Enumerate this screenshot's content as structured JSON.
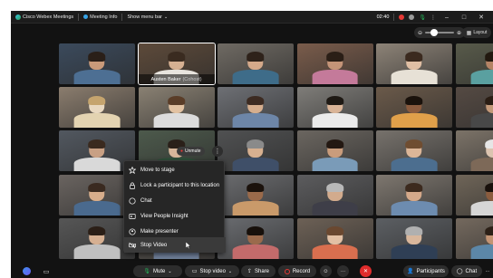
{
  "titlebar": {
    "app_name": "Cisco Webex Meetings",
    "meeting_info": "Meeting Info",
    "show_menu_bar": "Show menu bar",
    "time": "02:40"
  },
  "top_controls": {
    "layout_label": "Layout",
    "zoom_level": 0.3
  },
  "tiles": [
    {
      "bg": "#3b4a5c",
      "skin": "#c99a7a",
      "hair": "#2a1f18",
      "shirt": "#4d6f93"
    },
    {
      "bg": "#5d4a3a",
      "skin": "#d6b092",
      "hair": "#3a2b20",
      "shirt": "#e8e4de",
      "name": "Austen Baker",
      "role": "(Cohost)",
      "active": true
    },
    {
      "bg": "#6f6a63",
      "skin": "#d4a98a",
      "hair": "#2e221a",
      "shirt": "#3e6c89"
    },
    {
      "bg": "#7a5c4b",
      "skin": "#c49478",
      "hair": "#2a1e16",
      "shirt": "#c47a9a"
    },
    {
      "bg": "#8d8377",
      "skin": "#e0bfa4",
      "hair": "#3b2a1f",
      "shirt": "#e7e1d6"
    },
    {
      "bg": "#585a4a",
      "skin": "#b48365",
      "hair": "#22180f",
      "shirt": "#5aa0a0"
    },
    {
      "bg": "#8b7d6e",
      "skin": "#e8d8c0",
      "hair": "#c5a46e",
      "shirt": "#e3d3b1"
    },
    {
      "bg": "#8a8173",
      "skin": "#e2c2a2",
      "hair": "#5a3d28",
      "shirt": "#dcdcdc"
    },
    {
      "bg": "#6e7075",
      "skin": "#d5ae8e",
      "hair": "#3c2b22",
      "shirt": "#6d86a8"
    },
    {
      "bg": "#7f7d79",
      "skin": "#d9b497",
      "hair": "#1e1914",
      "shirt": "#ebebeb"
    },
    {
      "bg": "#6b5a4a",
      "skin": "#8a5b3e",
      "hair": "#1a120c",
      "shirt": "#e0a04a"
    },
    {
      "bg": "#554a43",
      "skin": "#c49a7a",
      "hair": "#2a1d14",
      "shirt": "#484848"
    },
    {
      "bg": "#525860",
      "skin": "#c8a084",
      "hair": "#3a2a1f",
      "shirt": "#d9d9d9"
    },
    {
      "bg": "#4d5a4c",
      "skin": "#d6b69a",
      "hair": "#2a2019",
      "shirt": "#2f4f3a"
    },
    {
      "bg": "#505152",
      "skin": "#d7b090",
      "hair": "#8a8a8a",
      "shirt": "#3f4f68"
    },
    {
      "bg": "#6b6660",
      "skin": "#c99c7c",
      "hair": "#231812",
      "shirt": "#7a9bb8"
    },
    {
      "bg": "#77726c",
      "skin": "#dcb698",
      "hair": "#6f4d31",
      "shirt": "#4c6e8f"
    },
    {
      "bg": "#7c7368",
      "skin": "#dcc4b0",
      "hair": "#e6e6e6",
      "shirt": "#7d6958"
    },
    {
      "bg": "#6a6460",
      "skin": "#d7ad8b",
      "hair": "#3a2a20",
      "shirt": "#4a6a8e"
    },
    {
      "bg": "#59534b",
      "skin": "#d4ab8e",
      "hair": "#2d2218",
      "shirt": "#8fb0c9"
    },
    {
      "bg": "#6b6c6f",
      "skin": "#9a6a4a",
      "hair": "#1b120c",
      "shirt": "#c99a6a"
    },
    {
      "bg": "#5c5c5e",
      "skin": "#d2ab8d",
      "hair": "#b8b8b8",
      "shirt": "#3e3e48"
    },
    {
      "bg": "#7e776f",
      "skin": "#d5a98a",
      "hair": "#3c2a1e",
      "shirt": "#6d8cb0"
    },
    {
      "bg": "#6f6558",
      "skin": "#8b5c3e",
      "hair": "#18100b",
      "shirt": "#d6d6d6"
    },
    {
      "bg": "#565656",
      "skin": "#d6b092",
      "hair": "#2b1f17",
      "shirt": "#c0c0c0"
    },
    {
      "bg": "#5f5a54",
      "skin": "#d4ae92",
      "hair": "#2a1f17",
      "shirt": "#70809a"
    },
    {
      "bg": "#6a6c70",
      "skin": "#9a6a4c",
      "hair": "#17100b",
      "shirt": "#c36b6b"
    },
    {
      "bg": "#6d6156",
      "skin": "#e2c0a4",
      "hair": "#6a4830",
      "shirt": "#d96f4f"
    },
    {
      "bg": "#5c5f63",
      "skin": "#d9b79c",
      "hair": "#b0b0b0",
      "shirt": "#2f3f55"
    },
    {
      "bg": "#74695e",
      "skin": "#c39474",
      "hair": "#2c2017",
      "shirt": "#5c87a8"
    }
  ],
  "tile_overlay": {
    "unmute_label": "Unmute",
    "more_glyph": "⋮"
  },
  "context_menu": {
    "items": [
      {
        "label": "Move to stage"
      },
      {
        "label": "Lock a participant to this location"
      },
      {
        "label": "Chat"
      },
      {
        "label": "View People Insight"
      },
      {
        "label": "Make presenter"
      },
      {
        "label": "Stop Video"
      }
    ]
  },
  "bottombar": {
    "mute_label": "Mute",
    "stop_video_label": "Stop video",
    "share_label": "Share",
    "record_label": "Record",
    "participants_label": "Participants",
    "chat_label": "Chat",
    "more_glyph": "···",
    "end_glyph": "✕",
    "reactions_glyph": "☺"
  },
  "colors": {
    "accent_green": "#24b85a",
    "end_red": "#e02c2c",
    "record_red": "#e53935",
    "background": "#121212"
  }
}
